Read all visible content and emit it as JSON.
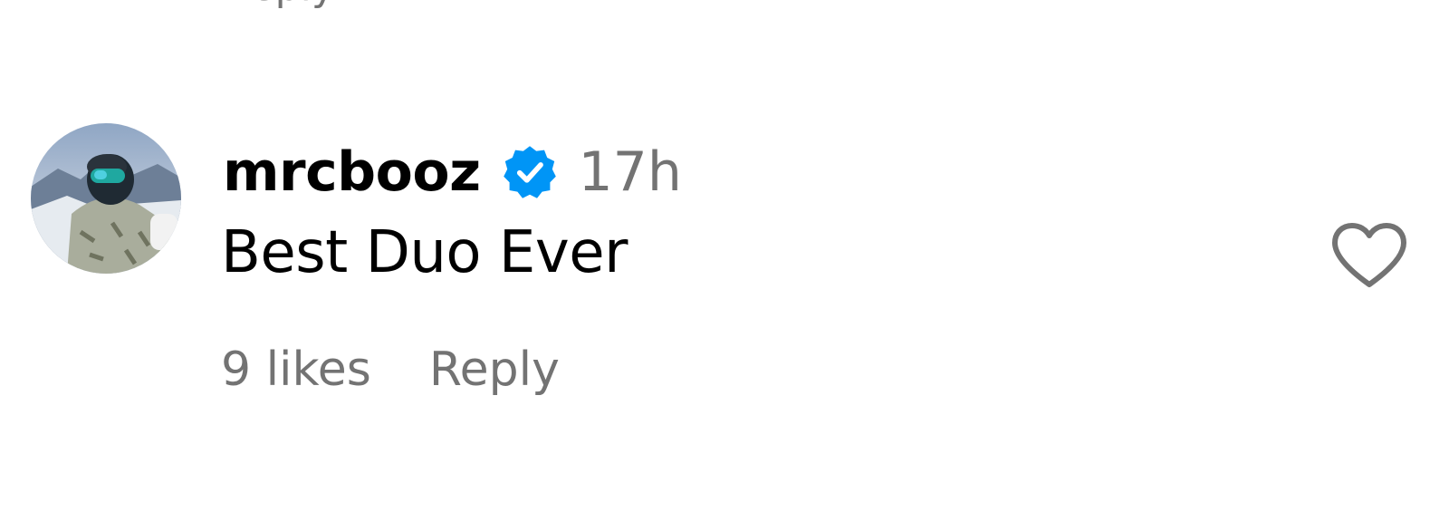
{
  "comment": {
    "username": "mrcbooz",
    "verified": true,
    "timestamp": "17h",
    "text": "Best Duo Ever",
    "likes_label": "9 likes",
    "reply_label": "Reply"
  },
  "previous_reply_label": "Reply",
  "icons": {
    "verified": "verified-badge-icon",
    "like": "heart-icon"
  },
  "colors": {
    "text_primary": "#000000",
    "text_secondary": "#737373",
    "verified_blue": "#0095F6"
  }
}
